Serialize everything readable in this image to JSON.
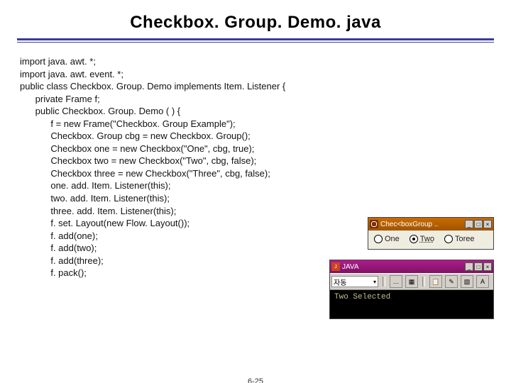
{
  "title": "Checkbox. Group. Demo. java",
  "code": "import java. awt. *;\nimport java. awt. event. *;\npublic class Checkbox. Group. Demo implements Item. Listener {\n      private Frame f;\n      public Checkbox. Group. Demo ( ) {\n            f = new Frame(\"Checkbox. Group Example\");\n            Checkbox. Group cbg = new Checkbox. Group();\n            Checkbox one = new Checkbox(\"One\", cbg, true);\n            Checkbox two = new Checkbox(\"Two\", cbg, false);\n            Checkbox three = new Checkbox(\"Three\", cbg, false);\n            one. add. Item. Listener(this);\n            two. add. Item. Listener(this);\n            three. add. Item. Listener(this);\n            f. set. Layout(new Flow. Layout());\n            f. add(one);\n            f. add(two);\n            f. add(three);\n            f. pack();",
  "page_number": "6-25",
  "window_checkbox": {
    "title": "Chec<boxGroup ..",
    "options": [
      "One",
      "Two",
      "Toree"
    ],
    "selected": "Two"
  },
  "window_console": {
    "title": "JAVA",
    "select_label": "자동",
    "output": "Two Selected"
  },
  "tb_icons": {
    "min": "_",
    "max": "□",
    "close": "×"
  },
  "tool_icons": {
    "t1": "…",
    "t2": "▦",
    "t3": "📋",
    "t4": "✎",
    "t5": "▧",
    "t6": "A"
  }
}
